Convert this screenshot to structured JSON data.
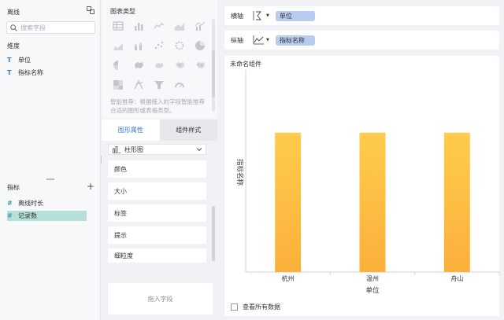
{
  "left_panel": {
    "dataset_title": "离线",
    "search_placeholder": "搜索字段",
    "dimension_title": "维度",
    "dimensions": [
      {
        "icon": "T",
        "label": "单位"
      },
      {
        "icon": "T",
        "label": "指标名称"
      }
    ],
    "measure_title": "指标",
    "measures": [
      {
        "icon": "#",
        "label": "离线时长"
      },
      {
        "icon": "#",
        "label": "记录数"
      }
    ]
  },
  "chart_types": {
    "title": "图表类型",
    "hint": "智能推荐：根据拖入的字段智能推荐合适的图形或表格类型。"
  },
  "tabs": {
    "graph_attr": "图形属性",
    "component_style": "组件样式"
  },
  "props": {
    "chart_type": "柱形图",
    "rows": [
      "颜色",
      "大小",
      "标签",
      "提示",
      "细粒度"
    ]
  },
  "drop_zone": "拖入字段",
  "axes": {
    "x_label": "横轴",
    "x_field": "单位",
    "y_label": "纵轴",
    "y_field": "指标名称"
  },
  "component": {
    "name": "未命名组件",
    "show_all": "查看所有数据"
  },
  "colors": {
    "bar_top": "#ffcc4d",
    "bar_bottom": "#fbb03b",
    "accent": "#3b78d8"
  },
  "chart_data": {
    "type": "bar",
    "categories": [
      "杭州",
      "温州",
      "舟山"
    ],
    "values": [
      1,
      1,
      1
    ],
    "xlabel": "单位",
    "ylabel": "指标名称",
    "ylim": [
      0,
      1.45
    ]
  }
}
